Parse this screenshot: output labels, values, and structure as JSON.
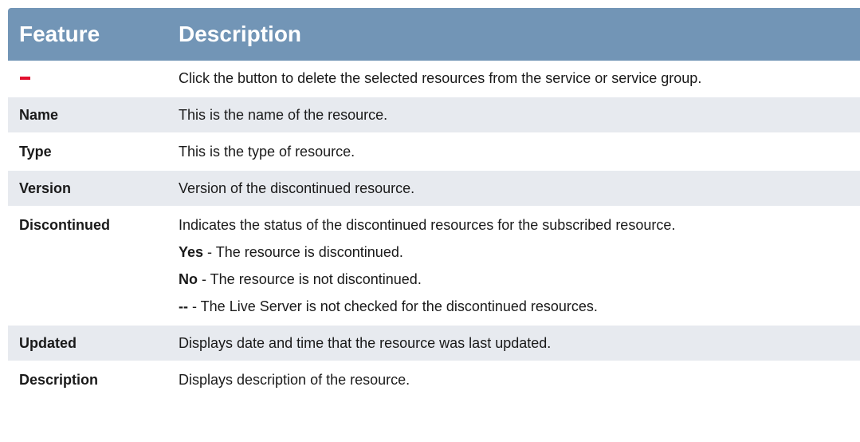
{
  "table": {
    "header": {
      "feature": "Feature",
      "description": "Description"
    },
    "rows": [
      {
        "feature_icon": "minus-icon",
        "icon_color": "#e2102f",
        "description": "Click the button to delete the selected resources from the service or service group."
      },
      {
        "feature": "Name",
        "description": "This is the name of the resource."
      },
      {
        "feature": "Type",
        "description": "This is the type of resource."
      },
      {
        "feature": "Version",
        "description": "Version of the discontinued resource."
      },
      {
        "feature": "Discontinued",
        "description": "Indicates the status of the discontinued resources for the subscribed resource.",
        "options": [
          {
            "term": "Yes",
            "text": " - The resource is discontinued."
          },
          {
            "term": "No",
            "text": " - The resource is not discontinued."
          },
          {
            "term": "--",
            "text": " - The Live Server is not checked for the discontinued resources."
          }
        ]
      },
      {
        "feature": "Updated",
        "description": "Displays date and time that the resource was last updated."
      },
      {
        "feature": "Description",
        "description": "Displays description of the resource."
      }
    ]
  },
  "colors": {
    "header_bg": "#7295b6",
    "header_text": "#ffffff",
    "stripe_bg": "#e7eaef"
  }
}
